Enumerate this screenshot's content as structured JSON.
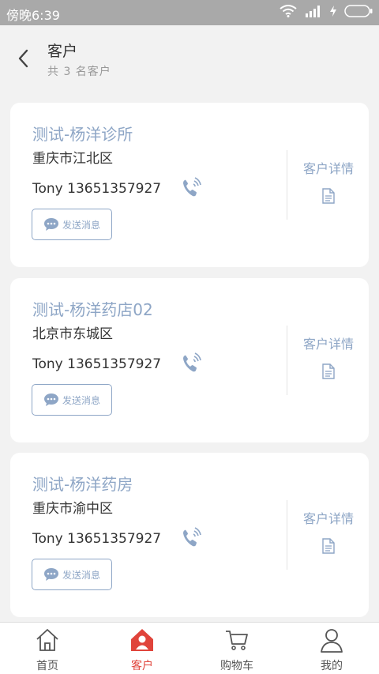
{
  "status_bar": {
    "time": "傍晚6:39"
  },
  "header": {
    "title": "客户",
    "subtitle": "共 3 名客户"
  },
  "customers": [
    {
      "name": "测试-杨洋诊所",
      "address": "重庆市江北区",
      "contact": "Tony 13651357927",
      "message_label": "发送消息",
      "detail_label": "客户详情"
    },
    {
      "name": "测试-杨洋药店02",
      "address": "北京市东城区",
      "contact": "Tony 13651357927",
      "message_label": "发送消息",
      "detail_label": "客户详情"
    },
    {
      "name": "测试-杨洋药房",
      "address": "重庆市渝中区",
      "contact": "Tony 13651357927",
      "message_label": "发送消息",
      "detail_label": "客户详情"
    }
  ],
  "tabs": [
    {
      "label": "首页",
      "icon": "home-icon"
    },
    {
      "label": "客户",
      "icon": "customer-icon",
      "active": true
    },
    {
      "label": "购物车",
      "icon": "cart-icon"
    },
    {
      "label": "我的",
      "icon": "profile-icon"
    }
  ],
  "colors": {
    "accent": "#8ea6c6",
    "active_tab": "#e0443b",
    "status_bar": "#a9a9a9"
  }
}
